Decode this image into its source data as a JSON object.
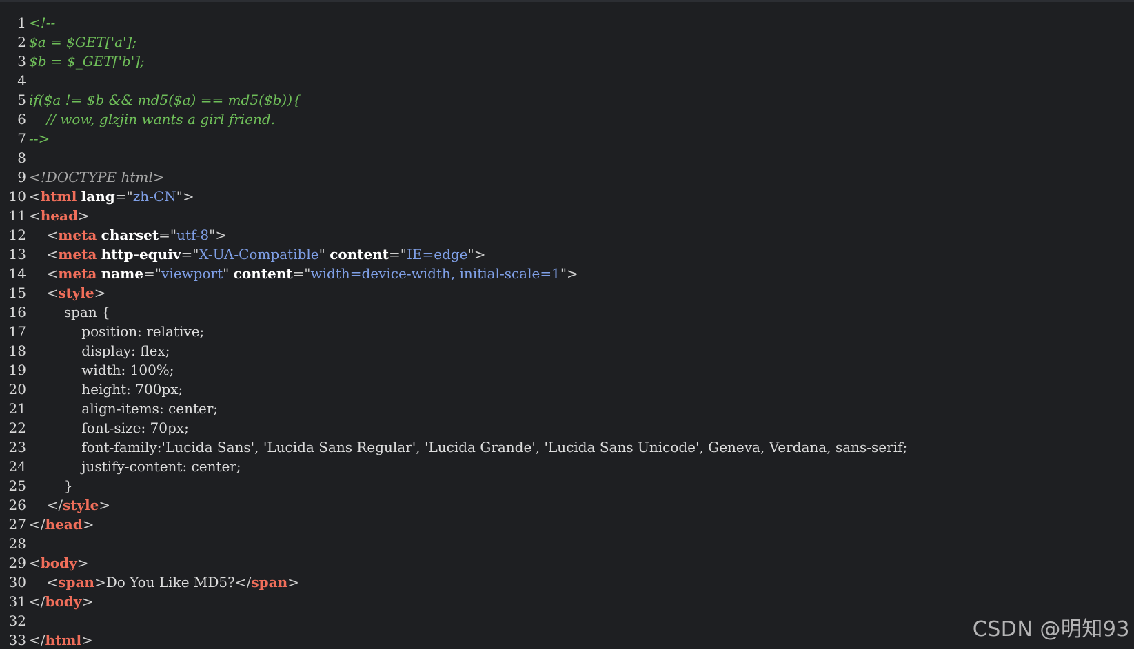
{
  "editor": {
    "lines": [
      {
        "n": "1",
        "t": [
          [
            "comment",
            "<!--"
          ]
        ]
      },
      {
        "n": "2",
        "t": [
          [
            "comment",
            "$a = $GET['a'];"
          ]
        ]
      },
      {
        "n": "3",
        "t": [
          [
            "comment",
            "$b = $_GET['b'];"
          ]
        ]
      },
      {
        "n": "4",
        "t": []
      },
      {
        "n": "5",
        "t": [
          [
            "comment",
            "if($a != $b && md5($a) == md5($b)){"
          ]
        ]
      },
      {
        "n": "6",
        "t": [
          [
            "comment",
            "    // wow, glzjin wants a girl friend."
          ]
        ]
      },
      {
        "n": "7",
        "t": [
          [
            "comment",
            "-->"
          ]
        ]
      },
      {
        "n": "8",
        "t": []
      },
      {
        "n": "9",
        "t": [
          [
            "doctype",
            "<!DOCTYPE html>"
          ]
        ]
      },
      {
        "n": "10",
        "t": [
          [
            "punct",
            "<"
          ],
          [
            "tag",
            "html"
          ],
          [
            "plain",
            " "
          ],
          [
            "attr",
            "lang"
          ],
          [
            "punct",
            "=\""
          ],
          [
            "str",
            "zh-CN"
          ],
          [
            "punct",
            "\">"
          ]
        ]
      },
      {
        "n": "11",
        "t": [
          [
            "punct",
            "<"
          ],
          [
            "tag",
            "head"
          ],
          [
            "punct",
            ">"
          ]
        ]
      },
      {
        "n": "12",
        "t": [
          [
            "plain",
            "    "
          ],
          [
            "punct",
            "<"
          ],
          [
            "tag",
            "meta"
          ],
          [
            "plain",
            " "
          ],
          [
            "attr",
            "charset"
          ],
          [
            "punct",
            "=\""
          ],
          [
            "str",
            "utf-8"
          ],
          [
            "punct",
            "\">"
          ]
        ]
      },
      {
        "n": "13",
        "t": [
          [
            "plain",
            "    "
          ],
          [
            "punct",
            "<"
          ],
          [
            "tag",
            "meta"
          ],
          [
            "plain",
            " "
          ],
          [
            "attr",
            "http-equiv"
          ],
          [
            "punct",
            "=\""
          ],
          [
            "str",
            "X-UA-Compatible"
          ],
          [
            "punct",
            "\" "
          ],
          [
            "attr",
            "content"
          ],
          [
            "punct",
            "=\""
          ],
          [
            "str",
            "IE=edge"
          ],
          [
            "punct",
            "\">"
          ]
        ]
      },
      {
        "n": "14",
        "t": [
          [
            "plain",
            "    "
          ],
          [
            "punct",
            "<"
          ],
          [
            "tag",
            "meta"
          ],
          [
            "plain",
            " "
          ],
          [
            "attr",
            "name"
          ],
          [
            "punct",
            "=\""
          ],
          [
            "str",
            "viewport"
          ],
          [
            "punct",
            "\" "
          ],
          [
            "attr",
            "content"
          ],
          [
            "punct",
            "=\""
          ],
          [
            "str",
            "width=device-width, initial-scale=1"
          ],
          [
            "punct",
            "\">"
          ]
        ]
      },
      {
        "n": "15",
        "t": [
          [
            "plain",
            "    "
          ],
          [
            "punct",
            "<"
          ],
          [
            "tag",
            "style"
          ],
          [
            "punct",
            ">"
          ]
        ]
      },
      {
        "n": "16",
        "t": [
          [
            "plain",
            "        span {"
          ]
        ]
      },
      {
        "n": "17",
        "t": [
          [
            "plain",
            "            position: relative;"
          ]
        ]
      },
      {
        "n": "18",
        "t": [
          [
            "plain",
            "            display: flex;"
          ]
        ]
      },
      {
        "n": "19",
        "t": [
          [
            "plain",
            "            width: 100%;"
          ]
        ]
      },
      {
        "n": "20",
        "t": [
          [
            "plain",
            "            height: 700px;"
          ]
        ]
      },
      {
        "n": "21",
        "t": [
          [
            "plain",
            "            align-items: center;"
          ]
        ]
      },
      {
        "n": "22",
        "t": [
          [
            "plain",
            "            font-size: 70px;"
          ]
        ]
      },
      {
        "n": "23",
        "t": [
          [
            "plain",
            "            font-family:'Lucida Sans', 'Lucida Sans Regular', 'Lucida Grande', 'Lucida Sans Unicode', Geneva, Verdana, sans-serif;"
          ]
        ]
      },
      {
        "n": "24",
        "t": [
          [
            "plain",
            "            justify-content: center;"
          ]
        ]
      },
      {
        "n": "25",
        "t": [
          [
            "plain",
            "        }"
          ]
        ]
      },
      {
        "n": "26",
        "t": [
          [
            "plain",
            "    "
          ],
          [
            "punct",
            "</"
          ],
          [
            "tag",
            "style"
          ],
          [
            "punct",
            ">"
          ]
        ]
      },
      {
        "n": "27",
        "t": [
          [
            "punct",
            "</"
          ],
          [
            "tag",
            "head"
          ],
          [
            "punct",
            ">"
          ]
        ]
      },
      {
        "n": "28",
        "t": []
      },
      {
        "n": "29",
        "t": [
          [
            "punct",
            "<"
          ],
          [
            "tag",
            "body"
          ],
          [
            "punct",
            ">"
          ]
        ]
      },
      {
        "n": "30",
        "t": [
          [
            "plain",
            "    "
          ],
          [
            "punct",
            "<"
          ],
          [
            "tag",
            "span"
          ],
          [
            "punct",
            ">"
          ],
          [
            "plain",
            "Do You Like MD5?"
          ],
          [
            "punct",
            "</"
          ],
          [
            "tag",
            "span"
          ],
          [
            "punct",
            ">"
          ]
        ]
      },
      {
        "n": "31",
        "t": [
          [
            "punct",
            "</"
          ],
          [
            "tag",
            "body"
          ],
          [
            "punct",
            ">"
          ]
        ]
      },
      {
        "n": "32",
        "t": []
      },
      {
        "n": "33",
        "t": [
          [
            "punct",
            "</"
          ],
          [
            "tag",
            "html"
          ],
          [
            "punct",
            ">"
          ]
        ]
      }
    ]
  },
  "watermark": "CSDN @明知93",
  "colors": {
    "background": "#1e1f22",
    "comment": "#6fbf59",
    "tag": "#f06e5a",
    "string": "#7f9fe6",
    "attribute": "#ffffff",
    "plain": "#dcdcdc"
  }
}
